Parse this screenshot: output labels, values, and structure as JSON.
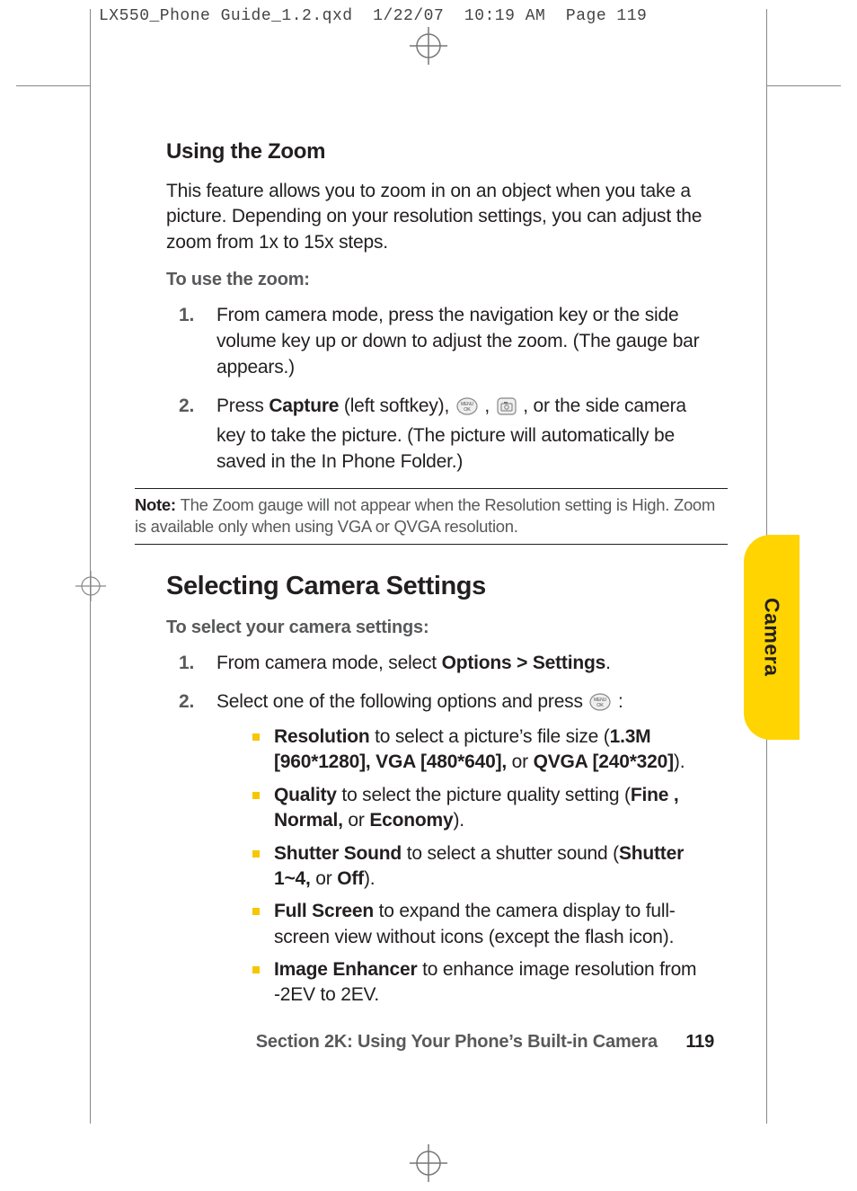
{
  "header": {
    "filename": "LX550_Phone Guide_1.2.qxd",
    "date": "1/22/07",
    "time": "10:19 AM",
    "pagelabel": "Page 119"
  },
  "sec_zoom": {
    "heading": "Using the Zoom",
    "intro": "This feature allows you to zoom in on an object when you take a picture. Depending on your resolution settings, you can adjust the zoom from 1x to 15x steps.",
    "leadin": "To use the zoom:",
    "step1": "From camera mode, press the navigation key or the side volume key up or down to adjust the zoom. (The gauge bar appears.)",
    "step2_a": "Press ",
    "step2_capture": "Capture",
    "step2_b": " (left softkey), ",
    "step2_c": " , ",
    "step2_d": " , or the side camera key to take the picture. (The picture will automatically be saved in the In Phone Folder.)"
  },
  "note": {
    "label": "Note: ",
    "text": "The Zoom gauge will not appear when the Resolution setting is High. Zoom is available only when using VGA or QVGA resolution."
  },
  "sec_settings": {
    "heading": "Selecting Camera Settings",
    "leadin": "To select your camera settings:",
    "step1_a": "From camera mode, select ",
    "step1_bold": "Options > Settings",
    "step1_b": ".",
    "step2_a": "Select one of the following options and press ",
    "step2_b": " :",
    "bullets": {
      "res_a": "Resolution",
      "res_b": " to select a picture’s file size (",
      "res_c": "1.3M [960*1280], VGA [480*640],",
      "res_d": " or ",
      "res_e": "QVGA [240*320]",
      "res_f": ").",
      "qual_a": "Quality",
      "qual_b": " to select the picture quality setting (",
      "qual_c": "Fine , Normal,",
      "qual_d": " or ",
      "qual_e": "Economy",
      "qual_f": ").",
      "shut_a": "Shutter Sound",
      "shut_b": " to select a shutter sound (",
      "shut_c": "Shutter 1~4,",
      "shut_d": " or ",
      "shut_e": "Off",
      "shut_f": ").",
      "full_a": "Full Screen",
      "full_b": " to expand the camera display to full-screen view without icons (except the flash icon).",
      "img_a": "Image Enhancer",
      "img_b": " to enhance image resolution from -2EV to 2EV."
    }
  },
  "tab": "Camera",
  "footer": {
    "section": "Section 2K: Using Your Phone’s Built-in Camera",
    "page": "119"
  },
  "nums": {
    "n1": "1.",
    "n2": "2."
  }
}
